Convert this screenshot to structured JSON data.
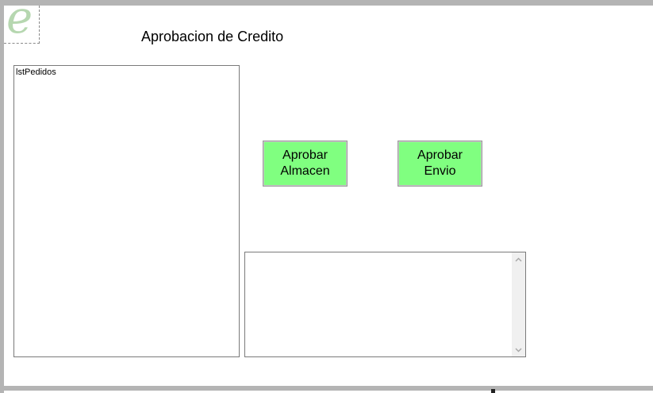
{
  "window": {
    "title": "Aprobacion de Credito",
    "logo_letter": "e"
  },
  "list": {
    "label": "lstPedidos"
  },
  "buttons": {
    "almacen": {
      "line1": "Aprobar",
      "line2": "Almacen"
    },
    "envio": {
      "line1": "Aprobar",
      "line2": "Envio"
    }
  },
  "colors": {
    "button_bg": "#80ff80",
    "logo": "#b6d7b0",
    "frame_border": "#b4b4b4"
  },
  "icons": {
    "logo": "letter-e-logo-icon",
    "scroll_up": "chevron-up-icon",
    "scroll_down": "chevron-down-icon"
  }
}
